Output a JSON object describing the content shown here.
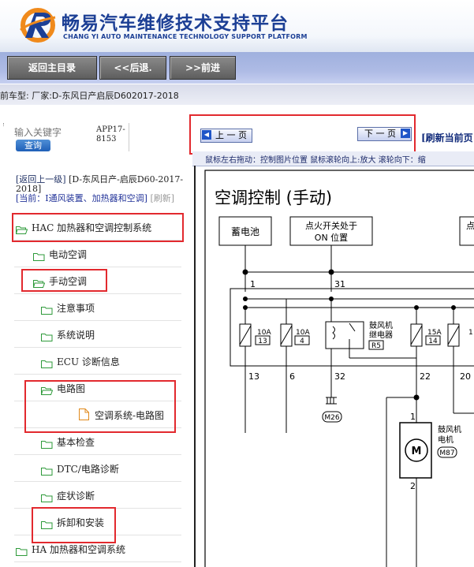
{
  "header": {
    "brand_cn": "畅易汽车维修技术支持平台",
    "brand_en": "CHANG YI AUTO MAINTENANCE TECHNOLOGY SUPPORT PLATFORM",
    "colors": {
      "brand_blue": "#1c3f95",
      "logo_orange": "#f08a1c"
    }
  },
  "toolbar": {
    "home_label": "返回主目录",
    "back_label": "<<后退.",
    "forward_label": ">>前进"
  },
  "vehicle": {
    "text": "前车型:  厂家:D-东风日产启辰D602017-2018"
  },
  "search": {
    "placeholder": "输入关键字",
    "button_label": "查询",
    "app_version": "APP17-8153"
  },
  "nav": {
    "up_level": "[返回上一级]",
    "model": "[D-东风日产-启辰D60-2017-2018]",
    "current": "[当前：I通风装置、加热器和空调]",
    "refresh": "[刷新]"
  },
  "tree": [
    {
      "label": "HAC 加热器和空调控制系统",
      "level": 0
    },
    {
      "label": "电动空调",
      "level": 1
    },
    {
      "label": "手动空调",
      "level": 1
    },
    {
      "label": "注意事项",
      "level": 2
    },
    {
      "label": "系统说明",
      "level": 2
    },
    {
      "label": "ECU 诊断信息",
      "level": 2
    },
    {
      "label": "电路图",
      "level": 2
    },
    {
      "label": "空调系统-电路图",
      "level": 3
    },
    {
      "label": "基本检查",
      "level": 2
    },
    {
      "label": "DTC/电路诊断",
      "level": 2
    },
    {
      "label": "症状诊断",
      "level": 2
    },
    {
      "label": "拆卸和安装",
      "level": 2
    },
    {
      "label": "HA 加热器和空调系统",
      "level": 0
    }
  ],
  "viewer": {
    "prev_label": "上 一 页",
    "next_label": "下 一 页",
    "refresh_label": "[刷新当前页",
    "hint": "鼠标左右拖动：控制图片位置 鼠标滚轮向上:放大  滚轮向下：缩"
  },
  "diagram": {
    "title": "空调控制 (手动)",
    "battery": "蓄电池",
    "ign_line1": "点火开关处于",
    "ign_line2": "ON 位置",
    "ign2_line1": "点",
    "wire_1": "1",
    "wire_31": "31",
    "fuse1_rating": "10A",
    "fuse1_no": "13",
    "fuse2_rating": "10A",
    "fuse2_no": "4",
    "relay_line1": "鼓风机",
    "relay_line2": "继电器",
    "relay_code": "R5",
    "fuse3_rating": "15A",
    "fuse3_no": "14",
    "fuse4_rating": "1",
    "out_13": "13",
    "out_6": "6",
    "out_32": "32",
    "out_22": "22",
    "out_20": "20",
    "m26": "M26",
    "motor_pin1": "1",
    "motor_pin2": "2",
    "motor_line1": "鼓风机",
    "motor_line2": "电机",
    "motor_code": "M87",
    "motor_symbol": "M"
  }
}
